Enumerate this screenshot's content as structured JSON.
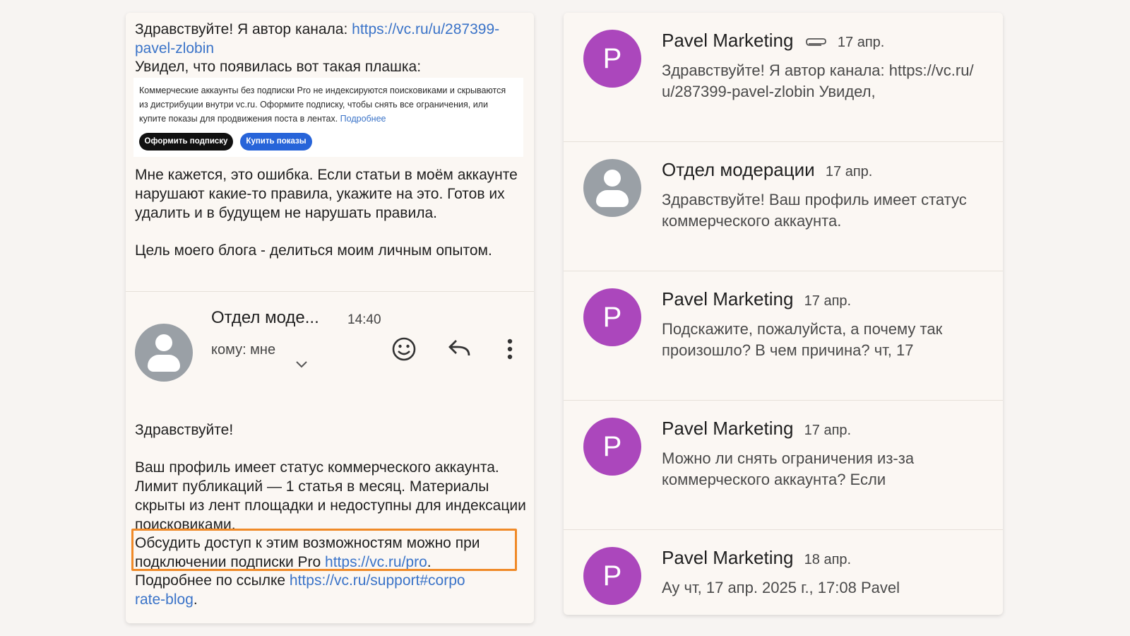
{
  "left": {
    "intro_text": "Здравствуйте! Я автор канала: ",
    "intro_link": "https://vc.ru/u/287399-pavel-zlobin",
    "saw_text": "Увидел, что появилась вот такая плашка:",
    "notice": {
      "text": "Коммерческие аккаунты без подписки Pro не индексируются поисковиками и скрываются из дистрибуции внутри vc.ru. Оформите подписку, чтобы снять все ограничения, или купите показы для продвижения поста в лентах. ",
      "more_link": "Подробнее",
      "subscribe_button": "Оформить подписку",
      "buy_button": "Купить показы"
    },
    "body_p1": "Мне кажется, это ошибка. Если статьи в моём аккаунте нарушают какие-то правила, укажите на это. Готов их удалить и в будущем не нарушать правила.",
    "body_p2": "Цель моего блога - делиться моим личным опытом.",
    "reply": {
      "sender": "Отдел моде...",
      "time": "14:40",
      "to": "кому: мне",
      "greeting": "Здравствуйте!",
      "p1": "Ваш профиль имеет статус коммерческого аккаунта. Лимит публикаций — 1 статья в месяц. Материалы скрыты из лент площадки и недоступны для индексации поисковиками.",
      "p2_text": "Обсудить доступ к этим возможностям можно при подключении подписки Pro ",
      "p2_link": "https://vc.ru/pro",
      "p3_text": "Подробнее по ссылке ",
      "p3_link": "https://vc.ru/support#corporate-blog",
      "period": "."
    }
  },
  "inbox": [
    {
      "initial": "P",
      "name": "Pavel Marketing",
      "date": "17 апр.",
      "attachment": true,
      "avatar": "purple",
      "snippet": "Здравствуйте! Я автор канала: https://vc.ru/u/287399-pavel-zlobin Увидел,"
    },
    {
      "initial": "",
      "name": "Отдел модерации",
      "date": "17 апр.",
      "attachment": false,
      "avatar": "gray",
      "snippet": "Здравствуйте! Ваш профиль имеет статус коммерческого аккаунта."
    },
    {
      "initial": "P",
      "name": "Pavel Marketing",
      "date": "17 апр.",
      "attachment": false,
      "avatar": "purple",
      "snippet": "Подскажите, пожалуйста, а почему так произошло? В чем причина? чт, 17"
    },
    {
      "initial": "P",
      "name": "Pavel Marketing",
      "date": "17 апр.",
      "attachment": false,
      "avatar": "purple",
      "snippet": "Можно ли снять ограничения из-за коммерческого аккаунта? Если"
    },
    {
      "initial": "P",
      "name": "Pavel Marketing",
      "date": "18 апр.",
      "attachment": false,
      "avatar": "purple",
      "snippet": "Ау чт, 17 апр. 2025 г., 17:08 Pavel"
    }
  ],
  "colors": {
    "accent_link": "#3a73c8",
    "avatar_purple": "#ab47bc",
    "avatar_gray": "#9aa0a6",
    "highlight": "#f08a28"
  }
}
